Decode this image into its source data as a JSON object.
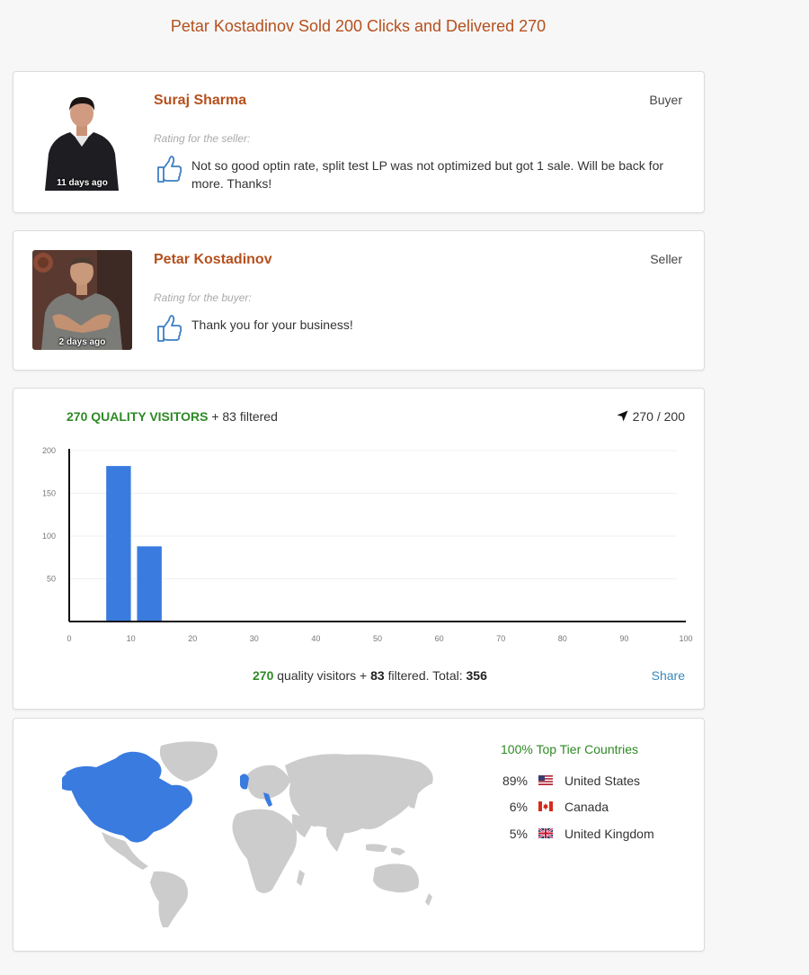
{
  "page_title": "Petar Kostadinov Sold 200 Clicks and Delivered 270",
  "reviews": [
    {
      "name": "Suraj Sharma",
      "role": "Buyer",
      "ago": "11 days ago",
      "rating_label": "Rating for the seller:",
      "comment": "Not so good optin rate, split test LP was not optimized but got 1 sale. Will be back for more. Thanks!"
    },
    {
      "name": "Petar Kostadinov",
      "role": "Seller",
      "ago": "2 days ago",
      "rating_label": "Rating for the buyer:",
      "comment": "Thank you for your business!"
    }
  ],
  "visitors": {
    "quality_label": "270 QUALITY VISITORS",
    "filtered_label": "+ 83 filtered",
    "delivered_ratio": "270 / 200",
    "footer": {
      "quality_count": "270",
      "quality_text": "quality visitors +",
      "filtered_count": "83",
      "filtered_text": "filtered. Total:",
      "total": "356"
    },
    "share_label": "Share",
    "accent_color": "#2e8a25",
    "bar_color": "#3a7be0"
  },
  "chart_data": {
    "type": "bar",
    "title": "",
    "xlabel": "",
    "ylabel": "",
    "x_ticks": [
      0,
      10,
      20,
      30,
      40,
      50,
      60,
      70,
      80,
      90,
      100
    ],
    "y_ticks": [
      50,
      100,
      150,
      200
    ],
    "xlim": [
      0,
      100
    ],
    "ylim": [
      0,
      200
    ],
    "bars": [
      {
        "x_start": 6,
        "x_end": 10,
        "value": 182
      },
      {
        "x_start": 11,
        "x_end": 15,
        "value": 88
      }
    ],
    "grid": true
  },
  "countries": {
    "title": "100% Top Tier Countries",
    "items": [
      {
        "pct": "89%",
        "name": "United States",
        "flag": "us-flag-icon"
      },
      {
        "pct": "6%",
        "name": "Canada",
        "flag": "ca-flag-icon"
      },
      {
        "pct": "5%",
        "name": "United Kingdom",
        "flag": "gb-flag-icon"
      }
    ],
    "highlight_color": "#3a7be0",
    "land_color": "#cccccc"
  }
}
